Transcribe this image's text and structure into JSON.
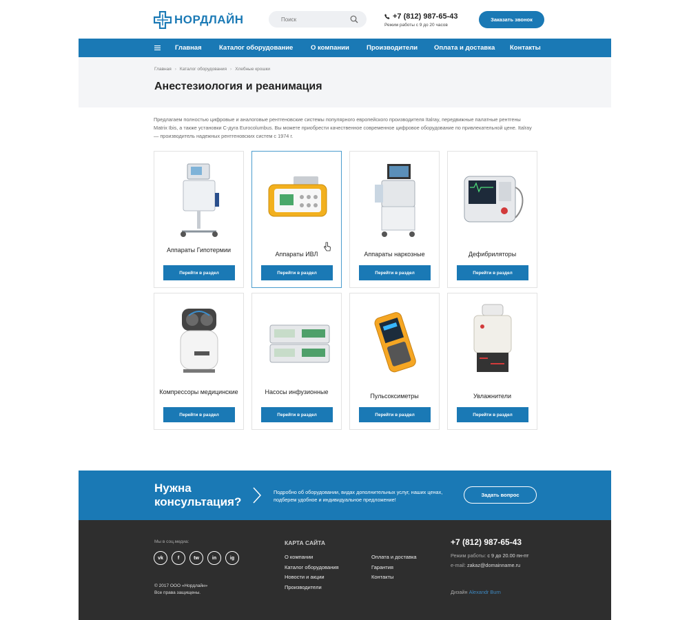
{
  "header": {
    "logo_text": "НОРДЛАЙН",
    "search_placeholder": "Поиск",
    "phone": "+7 (812) 987-65-43",
    "hours": "Режим работы с 9 до 20 часов",
    "call_label": "Заказать звонок"
  },
  "nav": {
    "items": [
      "Главная",
      "Каталог оборудование",
      "О компании",
      "Производители",
      "Оплата и доставка",
      "Контакты"
    ]
  },
  "breadcrumbs": [
    "Главная",
    "Каталог оборудования",
    "Хлебные крошки"
  ],
  "page_title": "Анестезиология и реанимация",
  "intro": "Предлагаем полностью цифровые и аналоговые рентгеновские системы популярного европейского производителя Italray, передвижные палатные рентгены Matrix Ibis, а также установки С-дуга Eurocolumbus. Вы можете приобрести качественное современное цифровое оборудование по привлекательной цене. Italray — производитель надежных рентгеновских систем с 1974 г.",
  "cards": [
    {
      "name": "Аппараты Гипотермии",
      "button": "Перейти в раздел"
    },
    {
      "name": "Аппараты ИВЛ",
      "button": "Перейти в раздел"
    },
    {
      "name": "Аппараты наркозные",
      "button": "Перейти в раздел"
    },
    {
      "name": "Дефибриляторы",
      "button": "Перейти в раздел"
    },
    {
      "name": "Компрессоры медицинские",
      "button": "Перейти в раздел"
    },
    {
      "name": "Насосы инфузионные",
      "button": "Перейти в раздел"
    },
    {
      "name": "Пульсоксиметры",
      "button": "Перейти в раздел"
    },
    {
      "name": "Увлажнители",
      "button": "Перейти в раздел"
    }
  ],
  "consult": {
    "title": "Нужна консультация?",
    "text": "Подробно об оборудовании, видах дополнительных услуг, наших ценах, подберем удобное и индивидуальное предложение!",
    "button": "Задать вопрос"
  },
  "footer": {
    "social_label": "Мы в соц.медиа:",
    "socials": [
      "vk",
      "f",
      "tw",
      "in",
      "ig"
    ],
    "copyright_1": "© 2017 ООО «Нордлайн»",
    "copyright_2": "Все права защищены.",
    "sitemap_title": "КАРТА САЙТА",
    "sitemap_col1": [
      "О компании",
      "Каталог оборудования",
      "Новости и акции",
      "Производители"
    ],
    "sitemap_col2": [
      "Оплата и доставка",
      "Гарантия",
      "Контакты"
    ],
    "phone": "+7 (812) 987-65-43",
    "hours_label": "Режим работы:",
    "hours_value": "с 9 до 20.00 пн-пт",
    "email_label": "e-mail:",
    "email_value": "zakaz@domainname.ru",
    "design_label": "Дизайн",
    "design_author": "Alexandr Burn"
  },
  "colors": {
    "brand_blue": "#1a79b5",
    "footer_bg": "#2e2e2e",
    "band_bg": "#f4f5f7"
  }
}
